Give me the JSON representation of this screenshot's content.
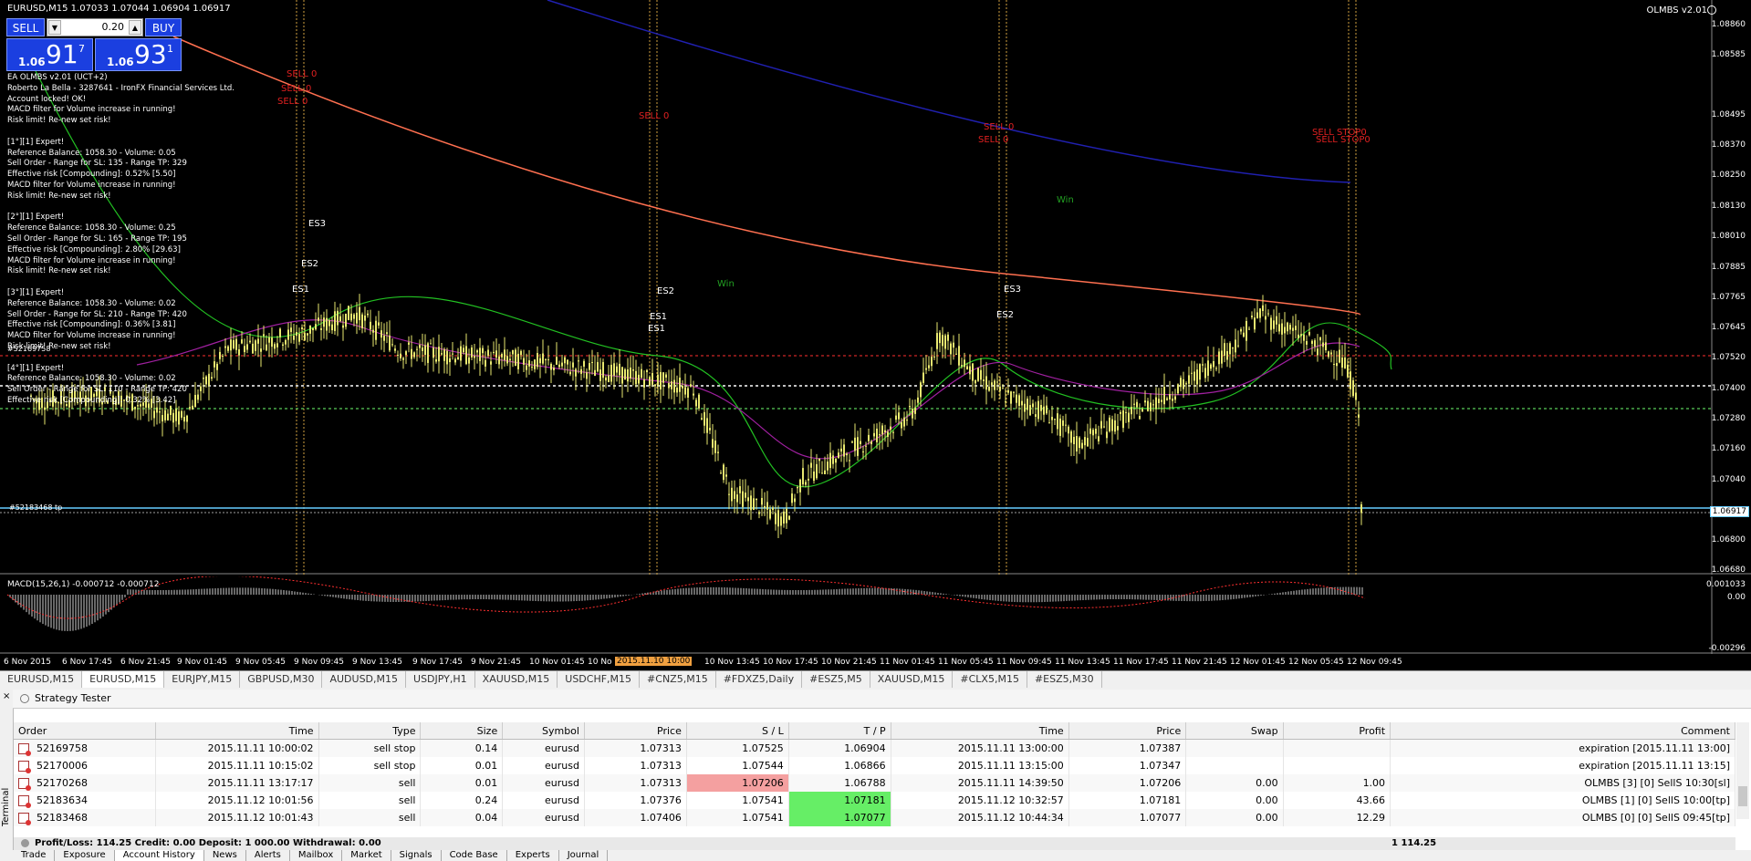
{
  "chart": {
    "title": "EURUSD,M15  1.07033 1.07044 1.06904 1.06917",
    "ea_name": "OLMBS v2.01",
    "trade_panel": {
      "sell_label": "SELL",
      "buy_label": "BUY",
      "lot": "0.20",
      "bid_small": "1.06",
      "bid_big": "91",
      "bid_sup": "7",
      "ask_small": "1.06",
      "ask_big": "93",
      "ask_sup": "1"
    },
    "info_lines": "EA OLMBS v2.01 (UCT+2)\nRoberto La Bella - 3287641 - IronFX Financial Services Ltd.\nAccount locked! OK!\nMACD filter for Volume increase in running!\nRisk limit! Re-new set risk!\n\n[1°][1] Expert!\nReference Balance: 1058.30 - Volume: 0.05\nSell Order - Range for SL: 135 - Range TP: 329\nEffective risk [Compounding]: 0.52% [5.50]\nMACD filter for Volume increase in running!\nRisk limit! Re-new set risk!\n\n[2°][1] Expert!\nReference Balance: 1058.30 - Volume: 0.25\nSell Order - Range for SL: 165 - Range TP: 195\nEffective risk [Compounding]: 2.80% [29.63]\nMACD filter for Volume increase in running!\nRisk limit! Re-new set risk!\n\n[3°][1] Expert!\nReference Balance: 1058.30 - Volume: 0.02\nSell Order - Range for SL: 210 - Range TP: 420\nEffective risk [Compounding]: 0.36% [3.81]\nMACD filter for Volume increase in running!\nRisk limit! Re-new set risk!\n\n[4°][1] Expert!\nReference Balance: 1058.30 - Volume: 0.02\nSell Order - Range for SL: 110 - Range TP: 420\nEffective risk [Compounding]: 0.32% [3.42]",
    "y_ticks": [
      "1.08860",
      "1.08585",
      "1.08495",
      "1.08370",
      "1.08250",
      "1.08130",
      "1.08010",
      "1.07885",
      "1.07765",
      "1.07645",
      "1.07520",
      "1.07400",
      "1.07280",
      "1.07160",
      "1.07040",
      "1.06917",
      "1.06800",
      "1.06680"
    ],
    "current_price": "1.06917",
    "x_ticks": [
      "6 Nov 2015",
      "6 Nov 17:45",
      "6 Nov 21:45",
      "9 Nov 01:45",
      "9 Nov 05:45",
      "9 Nov 09:45",
      "9 Nov 13:45",
      "9 Nov 17:45",
      "9 Nov 21:45",
      "10 Nov 01:45",
      "10 No",
      "10 Nov 13:45",
      "10 Nov 17:45",
      "10 Nov 21:45",
      "11 Nov 01:45",
      "11 Nov 05:45",
      "11 Nov 09:45",
      "11 Nov 13:45",
      "11 Nov 17:45",
      "11 Nov 21:45",
      "12 Nov 01:45",
      "12 Nov 05:45",
      "12 Nov 09:45"
    ],
    "highlight_date": "2015.11.10 10:00",
    "macd_title": "MACD(15,26,1) -0.000712 -0.000712",
    "macd_ticks": [
      "0.001033",
      "0.00",
      "-0.00296"
    ],
    "labels": {
      "sell0_a": "SELL 0",
      "sell0_b": "SELL 0",
      "sell0_c": "SELL 0",
      "sell0_d": "SELL 0",
      "sell0_e": "SELL 0",
      "sell0_f": "SELL 0",
      "sell_stop_a": "SELL STOP0",
      "sell_stop_b": "SELL STOP0",
      "win_a": "Win",
      "win_b": "Win",
      "es1_a": "ES1",
      "es2_a": "ES2",
      "es3_a": "ES3",
      "es1_b": "ES1",
      "es1_c": "ES1",
      "es2_b": "ES2",
      "es3_b": "ES3",
      "es2_c": "ES2",
      "order_tag_a": "#52169758",
      "order_tag_b": "#52183468 tp"
    }
  },
  "symbol_tabs": [
    "EURUSD,M15",
    "EURUSD,M15",
    "EURJPY,M15",
    "GBPUSD,M30",
    "AUDUSD,M15",
    "USDJPY,H1",
    "XAUUSD,M15",
    "USDCHF,M15",
    "#CNZ5,M15",
    "#FDXZ5,Daily",
    "#ESZ5,M5",
    "XAUUSD,M15",
    "#CLX5,M15",
    "#ESZ5,M30"
  ],
  "terminal": {
    "title": "Strategy Tester",
    "side_label": "Terminal",
    "columns": [
      "Order",
      "Time",
      "Type",
      "Size",
      "Symbol",
      "Price",
      "S / L",
      "T / P",
      "Time",
      "Price",
      "Swap",
      "Profit",
      "Comment"
    ],
    "rows": [
      {
        "order": "52169758",
        "time": "2015.11.11 10:00:02",
        "type": "sell stop",
        "size": "0.14",
        "symbol": "eurusd",
        "price": "1.07313",
        "sl": "1.07525",
        "tp": "1.06904",
        "close_time": "2015.11.11 13:00:00",
        "close_price": "1.07387",
        "swap": "",
        "profit": "",
        "comment": "expiration [2015.11.11 13:00]"
      },
      {
        "order": "52170006",
        "time": "2015.11.11 10:15:02",
        "type": "sell stop",
        "size": "0.01",
        "symbol": "eurusd",
        "price": "1.07313",
        "sl": "1.07544",
        "tp": "1.06866",
        "close_time": "2015.11.11 13:15:00",
        "close_price": "1.07347",
        "swap": "",
        "profit": "",
        "comment": "expiration [2015.11.11 13:15]"
      },
      {
        "order": "52170268",
        "time": "2015.11.11 13:17:17",
        "type": "sell",
        "size": "0.01",
        "symbol": "eurusd",
        "price": "1.07313",
        "sl": "1.07206",
        "tp": "1.06788",
        "close_time": "2015.11.11 14:39:50",
        "close_price": "1.07206",
        "swap": "0.00",
        "profit": "1.00",
        "comment": "OLMBS [3] [0] SellS 10:30[sl]"
      },
      {
        "order": "52183634",
        "time": "2015.11.12 10:01:56",
        "type": "sell",
        "size": "0.24",
        "symbol": "eurusd",
        "price": "1.07376",
        "sl": "1.07541",
        "tp": "1.07181",
        "close_time": "2015.11.12 10:32:57",
        "close_price": "1.07181",
        "swap": "0.00",
        "profit": "43.66",
        "comment": "OLMBS [1] [0] SellS 10:00[tp]"
      },
      {
        "order": "52183468",
        "time": "2015.11.12 10:01:43",
        "type": "sell",
        "size": "0.04",
        "symbol": "eurusd",
        "price": "1.07406",
        "sl": "1.07541",
        "tp": "1.07077",
        "close_time": "2015.11.12 10:44:34",
        "close_price": "1.07077",
        "swap": "0.00",
        "profit": "12.29",
        "comment": "OLMBS [0] [0] SellS 09:45[tp]"
      }
    ],
    "summary": "Profit/Loss: 114.25  Credit: 0.00  Deposit: 1 000.00  Withdrawal: 0.00",
    "summary_total": "1 114.25",
    "bottom_tabs": [
      "Trade",
      "Exposure",
      "Account History",
      "News",
      "Alerts",
      "Mailbox",
      "Market",
      "Signals",
      "Code Base",
      "Experts",
      "Journal"
    ]
  },
  "colors": {
    "candle": "#e8e870",
    "ma_green": "#22c022",
    "ma_magenta": "#a020a0",
    "ma_orange": "#ff7050",
    "ma_blue": "#2020b0",
    "sell_label": "#e02020",
    "panel_blue": "#1b3fe0"
  }
}
